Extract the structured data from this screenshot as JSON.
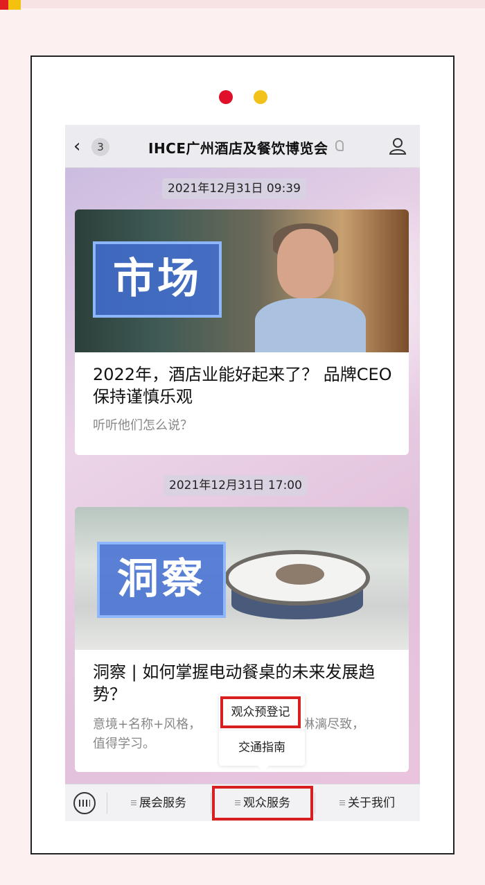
{
  "chat": {
    "title": "IHCE广州酒店及餐饮博览会",
    "unread_count": "3",
    "messages": [
      {
        "time": "2021年12月31日 09:39",
        "cover_label": "市场",
        "title": "2022年，酒店业能好起来了？ 品牌CEO保持谨慎乐观",
        "desc": "听听他们怎么说？"
      },
      {
        "time": "2021年12月31日 17:00",
        "cover_label": "洞察",
        "title": "洞察 | 如何掌握电动餐桌的未来发展趋势？",
        "desc": "意境+名称+风格，",
        "desc_tail": "得淋漓尽致，",
        "desc_line2": "值得学习。"
      }
    ]
  },
  "popup_menu": {
    "items": [
      "观众预登记",
      "交通指南"
    ]
  },
  "menubar": {
    "items": [
      "展会服务",
      "观众服务",
      "关于我们"
    ]
  },
  "colors": {
    "highlight": "#d81e1e",
    "accent_red": "#e0102a",
    "accent_yellow": "#f2c21a"
  }
}
